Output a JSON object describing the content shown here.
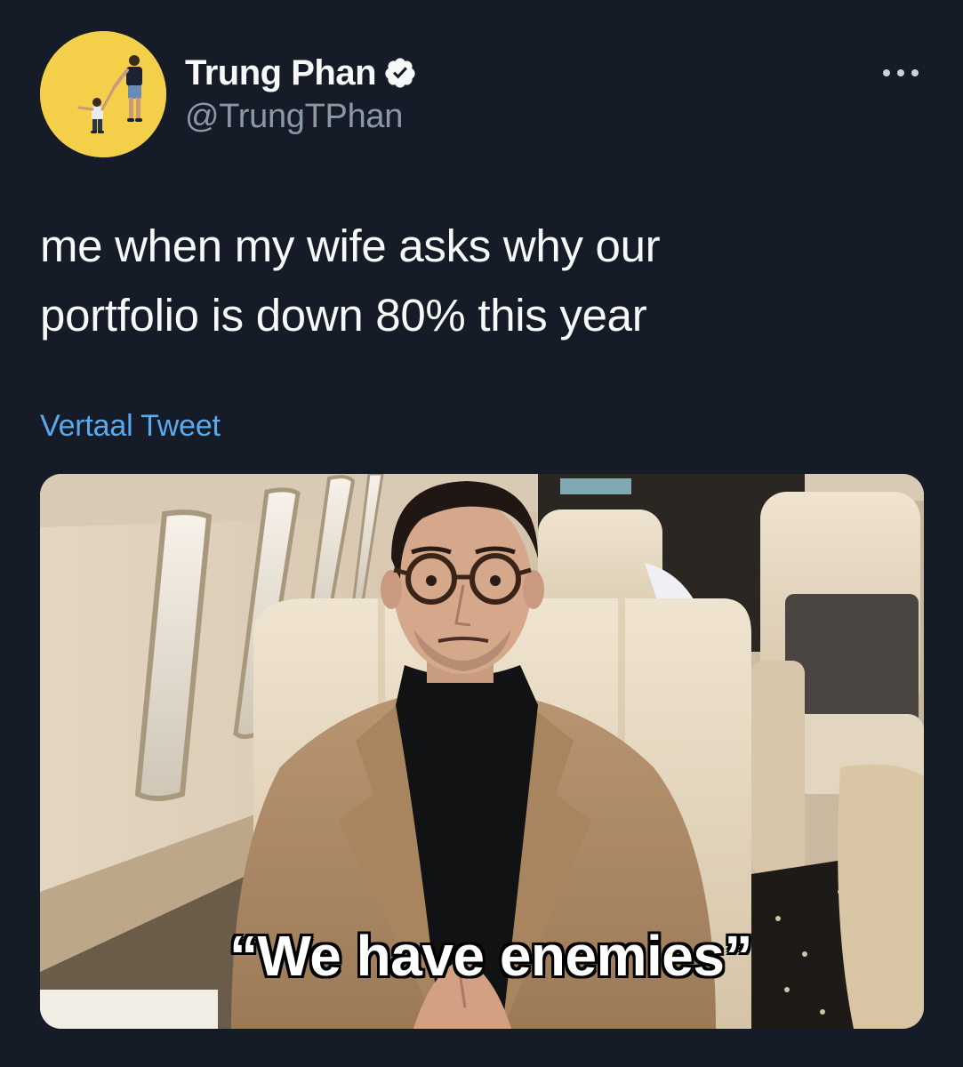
{
  "author": {
    "display_name": "Trung Phan",
    "handle": "@TrungTPhan",
    "avatar_icon": "avatar-father-and-child-icon",
    "verified": true,
    "verified_icon": "verified-badge-icon"
  },
  "menu": {
    "more_icon": "more-options-icon"
  },
  "tweet": {
    "text_line1": "me when my wife asks why our",
    "text_line2": "portfolio is down 80% this year",
    "translate_label": "Vertaal Tweet"
  },
  "media": {
    "caption": "“We have enemies”"
  },
  "colors": {
    "background": "#151c28",
    "primary_text": "#f7f9f9",
    "secondary_text": "#8b98a5",
    "link": "#5aaaee",
    "avatar_bg": "#f3cf4a"
  }
}
